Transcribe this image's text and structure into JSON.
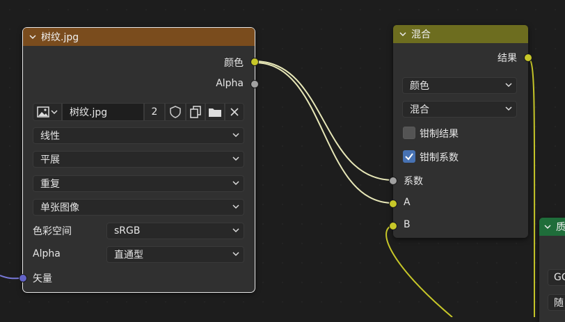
{
  "image_node": {
    "title": "树纹.jpg",
    "outputs": {
      "color": "颜色",
      "alpha": "Alpha"
    },
    "image_name": "树纹.jpg",
    "user_count": "2",
    "interpolation": "线性",
    "projection": "平展",
    "extension": "重复",
    "source": "单张图像",
    "color_space_label": "色彩空间",
    "color_space_value": "sRGB",
    "alpha_label": "Alpha",
    "alpha_value": "直通型",
    "vector_input": "矢量"
  },
  "mix_node": {
    "title": "混合",
    "output_result": "结果",
    "data_type": "颜色",
    "blend_mode": "混合",
    "clamp_result_label": "钳制结果",
    "clamp_result_checked": false,
    "clamp_factor_label": "钳制系数",
    "clamp_factor_checked": true,
    "inputs": {
      "factor": "系数",
      "a": "A",
      "b": "B"
    }
  },
  "partial_node": {
    "title": "质",
    "field1": "GG",
    "field2": "随"
  },
  "colors": {
    "image_header": "#7a4c1d",
    "mix_header": "#6d6d1f",
    "partial_header": "#1f6d3a",
    "socket_yellow": "#c7c729",
    "socket_grey": "#a1a1a1",
    "socket_purple": "#6363c7",
    "checkbox_on": "#4772b3"
  }
}
